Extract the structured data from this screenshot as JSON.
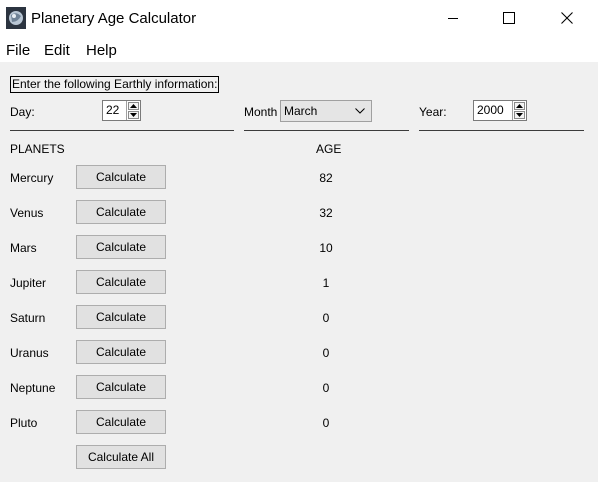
{
  "window": {
    "title": "Planetary Age Calculator",
    "app_icon": "planet-icon",
    "controls": [
      "minimize-icon",
      "maximize-icon",
      "close-icon"
    ]
  },
  "menu": {
    "items": [
      "File",
      "Edit",
      "Help"
    ]
  },
  "form": {
    "instruction": "Enter the following Earthly information:",
    "day_label": "Day:",
    "day_value": "22",
    "month_label": "Month",
    "month_value": "March",
    "year_label": "Year:",
    "year_value": "2000"
  },
  "table": {
    "planets_header": "PLANETS",
    "age_header": "AGE",
    "rows": [
      {
        "planet": "Mercury",
        "button": "Calculate",
        "age": "82"
      },
      {
        "planet": "Venus",
        "button": "Calculate",
        "age": "32"
      },
      {
        "planet": "Mars",
        "button": "Calculate",
        "age": "10"
      },
      {
        "planet": "Jupiter",
        "button": "Calculate",
        "age": "1"
      },
      {
        "planet": "Saturn",
        "button": "Calculate",
        "age": "0"
      },
      {
        "planet": "Uranus",
        "button": "Calculate",
        "age": "0"
      },
      {
        "planet": "Neptune",
        "button": "Calculate",
        "age": "0"
      },
      {
        "planet": "Pluto",
        "button": "Calculate",
        "age": "0"
      }
    ],
    "calculate_all_label": "Calculate All"
  }
}
